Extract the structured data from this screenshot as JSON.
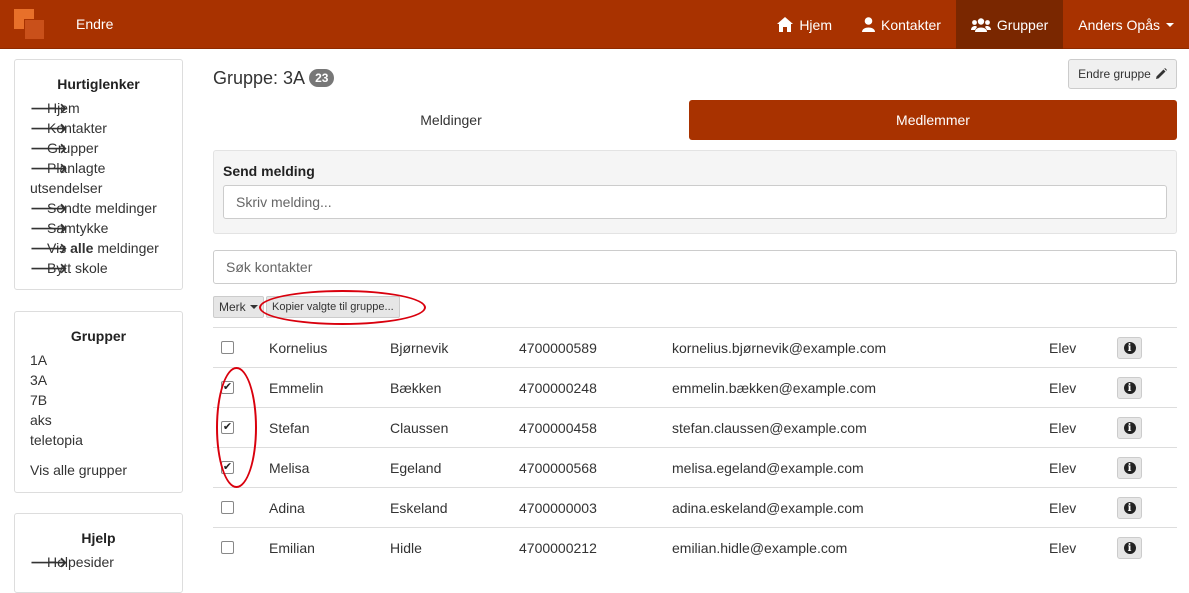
{
  "navbar": {
    "brand": "Endre",
    "items": [
      {
        "label": "Hjem",
        "icon": "home-icon"
      },
      {
        "label": "Kontakter",
        "icon": "user-icon"
      },
      {
        "label": "Grupper",
        "icon": "users-icon",
        "active": true
      }
    ],
    "user": "Anders Opås"
  },
  "sidebar": {
    "quicklinks_title": "Hurtiglenker",
    "quicklinks": [
      "Hjem",
      "Kontakter",
      "Grupper",
      "Planlagte utsendelser",
      "Sendte meldinger",
      "Samtykke",
      "Vis alle meldinger",
      "Bytt skole"
    ],
    "vis_alle_pre": "Vis ",
    "vis_alle_bold": "alle",
    "vis_alle_post": " meldinger",
    "groups_title": "Grupper",
    "groups": [
      "1A",
      "3A",
      "7B",
      "aks",
      "teletopia"
    ],
    "groups_all": "Vis alle grupper",
    "help_title": "Hjelp",
    "help_first": "Helpesider"
  },
  "main": {
    "title": "Gruppe: 3A",
    "count": "23",
    "edit_label": "Endre gruppe",
    "tabs": [
      "Meldinger",
      "Medlemmer"
    ],
    "send_title": "Send melding",
    "send_placeholder": "Skriv melding...",
    "search_placeholder": "Søk kontakter",
    "merk_label": "Merk",
    "copy_label": "Kopier valgte til gruppe...",
    "members": [
      {
        "first": "Kornelius",
        "last": "Bjørnevik",
        "phone": "4700000589",
        "email": "kornelius.bjørnevik@example.com",
        "role": "Elev",
        "checked": false
      },
      {
        "first": "Emmelin",
        "last": "Bækken",
        "phone": "4700000248",
        "email": "emmelin.bækken@example.com",
        "role": "Elev",
        "checked": true
      },
      {
        "first": "Stefan",
        "last": "Claussen",
        "phone": "4700000458",
        "email": "stefan.claussen@example.com",
        "role": "Elev",
        "checked": true
      },
      {
        "first": "Melisa",
        "last": "Egeland",
        "phone": "4700000568",
        "email": "melisa.egeland@example.com",
        "role": "Elev",
        "checked": true
      },
      {
        "first": "Adina",
        "last": "Eskeland",
        "phone": "4700000003",
        "email": "adina.eskeland@example.com",
        "role": "Elev",
        "checked": false
      },
      {
        "first": "Emilian",
        "last": "Hidle",
        "phone": "4700000212",
        "email": "emilian.hidle@example.com",
        "role": "Elev",
        "checked": false
      }
    ]
  },
  "colors": {
    "brand": "#a83200",
    "active_nav": "#7a2700",
    "annotation": "#d9000d"
  }
}
